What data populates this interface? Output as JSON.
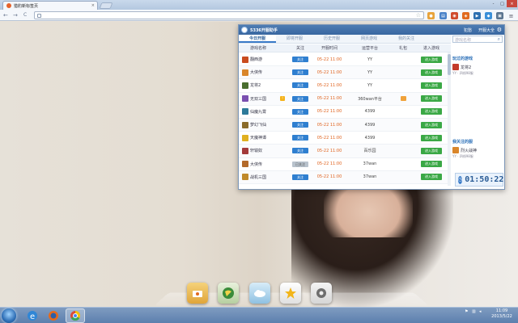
{
  "browser": {
    "tab_title": "猎豹新标签页",
    "tab_close": "×",
    "nav_back": "←",
    "nav_forward": "→",
    "nav_refresh": "C",
    "address_value": "",
    "window_controls": [
      "-",
      "□",
      "×"
    ]
  },
  "popup": {
    "title": "5336开服助手",
    "links": [
      "犯愁",
      "开服大全"
    ],
    "tabs": [
      "今日开服",
      "即将开服",
      "历史开服",
      "网页游戏",
      "我的关注"
    ],
    "active_tab": 0,
    "search_placeholder": "游戏名称",
    "columns": [
      "游戏名称",
      "关注",
      "开服时间",
      "运营平台",
      "礼包",
      "进入游戏"
    ],
    "rows": [
      {
        "name": "翻西游",
        "follow": "关注",
        "time": "05-22 11:00",
        "platform": "YY",
        "enter": "进入游戏",
        "flag": false,
        "gift": false
      },
      {
        "name": "大侠传",
        "follow": "关注",
        "time": "05-22 11:00",
        "platform": "YY",
        "enter": "进入游戏",
        "flag": false,
        "gift": false
      },
      {
        "name": "龙将2",
        "follow": "关注",
        "time": "05-22 11:00",
        "platform": "YY",
        "enter": "进入游戏",
        "flag": false,
        "gift": false
      },
      {
        "name": "无双三国",
        "follow": "关注",
        "time": "05-22 11:00",
        "platform": "360wan平台",
        "enter": "进入游戏",
        "flag": true,
        "gift": true
      },
      {
        "name": "仙魔九霄",
        "follow": "关注",
        "time": "05-22 11:00",
        "platform": "4399",
        "enter": "进入游戏",
        "flag": false,
        "gift": false
      },
      {
        "name": "梦幻飞仙",
        "follow": "关注",
        "time": "05-22 11:00",
        "platform": "4399",
        "enter": "进入游戏",
        "flag": false,
        "gift": false
      },
      {
        "name": "天魔神谭",
        "follow": "关注",
        "time": "05-22 11:00",
        "platform": "4399",
        "enter": "进入游戏",
        "flag": false,
        "gift": false
      },
      {
        "name": "轩辕奴",
        "follow": "关注",
        "time": "05-22 11:00",
        "platform": "百乐园",
        "enter": "进入游戏",
        "flag": false,
        "gift": false
      },
      {
        "name": "大侠传",
        "follow": "已关注",
        "time": "05-22 11:00",
        "platform": "37wan",
        "enter": "进入游戏",
        "flag": false,
        "gift": false
      },
      {
        "name": "战机三国",
        "follow": "关注",
        "time": "05-22 11:00",
        "platform": "37wan",
        "enter": "进入游戏",
        "flag": false,
        "gift": false
      }
    ],
    "side": {
      "played_heading": "玩过的游戏",
      "played_game": "龙将2",
      "played_sub": "YY · 四线98服",
      "followed_heading": "我关注的服",
      "followed_game": "烈火战神",
      "followed_sub": "YY · 四线98服"
    },
    "timer": "01:50:22"
  },
  "clock": {
    "time": "11:09",
    "date": "2013/5/22"
  },
  "colors": {
    "popup_header": "#3866a0",
    "follow_button": "#2f7fd0",
    "enter_button": "#3aa845",
    "open_time": "#e0621d"
  }
}
